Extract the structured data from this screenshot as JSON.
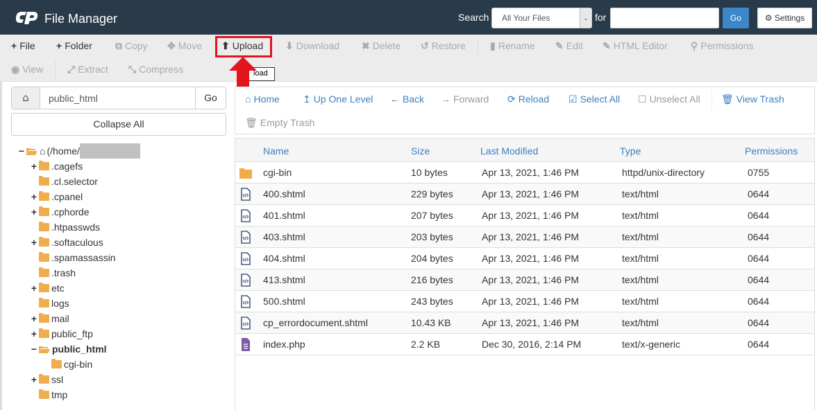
{
  "header": {
    "app_title": "File Manager",
    "search_label": "Search",
    "search_scope": "All Your Files",
    "for_label": "for",
    "search_value": "",
    "go_label": "Go",
    "settings_label": "Settings",
    "brand_color": "#293a4a",
    "accent_color": "#3d87c9"
  },
  "toolbar": {
    "row1": [
      {
        "label": "File",
        "icon": "plus-icon",
        "enabled": true
      },
      {
        "label": "Folder",
        "icon": "plus-icon",
        "enabled": true
      },
      {
        "label": "Copy",
        "icon": "copy-icon",
        "enabled": false
      },
      {
        "label": "Move",
        "icon": "move-icon",
        "enabled": false
      },
      {
        "label": "Upload",
        "icon": "upload-icon",
        "enabled": true
      },
      {
        "label": "Download",
        "icon": "download-icon",
        "enabled": false
      },
      {
        "label": "Delete",
        "icon": "delete-icon",
        "enabled": false
      },
      {
        "label": "Restore",
        "icon": "restore-icon",
        "enabled": false
      },
      {
        "label": "Rename",
        "icon": "rename-icon",
        "enabled": false
      },
      {
        "label": "Edit",
        "icon": "pencil-icon",
        "enabled": false
      },
      {
        "label": "HTML Editor",
        "icon": "html-editor-icon",
        "enabled": false
      },
      {
        "label": "Permissions",
        "icon": "key-icon",
        "enabled": false
      }
    ],
    "row2": [
      {
        "label": "View",
        "icon": "eye-icon",
        "enabled": false
      },
      {
        "label": "Extract",
        "icon": "expand-icon",
        "enabled": false
      },
      {
        "label": "Compress",
        "icon": "compress-icon",
        "enabled": false
      }
    ],
    "tooltip": "load",
    "highlight_color": "#e3141c"
  },
  "left_panel": {
    "path_value": "public_html",
    "go_label": "Go",
    "collapse_label": "Collapse All",
    "root_label": "(/home/",
    "tree": [
      {
        "label": ".cagefs",
        "expandable": true
      },
      {
        "label": ".cl.selector",
        "expandable": false
      },
      {
        "label": ".cpanel",
        "expandable": true
      },
      {
        "label": ".cphorde",
        "expandable": true
      },
      {
        "label": ".htpasswds",
        "expandable": false
      },
      {
        "label": ".softaculous",
        "expandable": true
      },
      {
        "label": ".spamassassin",
        "expandable": false
      },
      {
        "label": ".trash",
        "expandable": false
      },
      {
        "label": "etc",
        "expandable": true
      },
      {
        "label": "logs",
        "expandable": false
      },
      {
        "label": "mail",
        "expandable": true
      },
      {
        "label": "public_ftp",
        "expandable": true
      },
      {
        "label": "public_html",
        "expandable": true,
        "expanded": true,
        "selected": true
      },
      {
        "label": "cgi-bin",
        "expandable": false,
        "child": true
      },
      {
        "label": "ssl",
        "expandable": true
      },
      {
        "label": "tmp",
        "expandable": false
      }
    ]
  },
  "nav": {
    "home": "Home",
    "up_one_level": "Up One Level",
    "back": "Back",
    "forward": "Forward",
    "reload": "Reload",
    "select_all": "Select All",
    "unselect_all": "Unselect All",
    "view_trash": "View Trash",
    "empty_trash": "Empty Trash"
  },
  "table": {
    "headers": [
      "Name",
      "Size",
      "Last Modified",
      "Type",
      "Permissions"
    ],
    "rows": [
      {
        "icon": "folder-icon",
        "name": "cgi-bin",
        "size": "10 bytes",
        "modified": "Apr 13, 2021, 1:46 PM",
        "type": "httpd/unix-directory",
        "perms": "0755"
      },
      {
        "icon": "html-file-icon",
        "name": "400.shtml",
        "size": "229 bytes",
        "modified": "Apr 13, 2021, 1:46 PM",
        "type": "text/html",
        "perms": "0644"
      },
      {
        "icon": "html-file-icon",
        "name": "401.shtml",
        "size": "207 bytes",
        "modified": "Apr 13, 2021, 1:46 PM",
        "type": "text/html",
        "perms": "0644"
      },
      {
        "icon": "html-file-icon",
        "name": "403.shtml",
        "size": "203 bytes",
        "modified": "Apr 13, 2021, 1:46 PM",
        "type": "text/html",
        "perms": "0644"
      },
      {
        "icon": "html-file-icon",
        "name": "404.shtml",
        "size": "204 bytes",
        "modified": "Apr 13, 2021, 1:46 PM",
        "type": "text/html",
        "perms": "0644"
      },
      {
        "icon": "html-file-icon",
        "name": "413.shtml",
        "size": "216 bytes",
        "modified": "Apr 13, 2021, 1:46 PM",
        "type": "text/html",
        "perms": "0644"
      },
      {
        "icon": "html-file-icon",
        "name": "500.shtml",
        "size": "243 bytes",
        "modified": "Apr 13, 2021, 1:46 PM",
        "type": "text/html",
        "perms": "0644"
      },
      {
        "icon": "html-file-icon",
        "name": "cp_errordocument.shtml",
        "size": "10.43 KB",
        "modified": "Apr 13, 2021, 1:46 PM",
        "type": "text/html",
        "perms": "0644"
      },
      {
        "icon": "text-file-icon",
        "name": "index.php",
        "size": "2.2 KB",
        "modified": "Dec 30, 2016, 2:14 PM",
        "type": "text/x-generic",
        "perms": "0644"
      }
    ]
  }
}
